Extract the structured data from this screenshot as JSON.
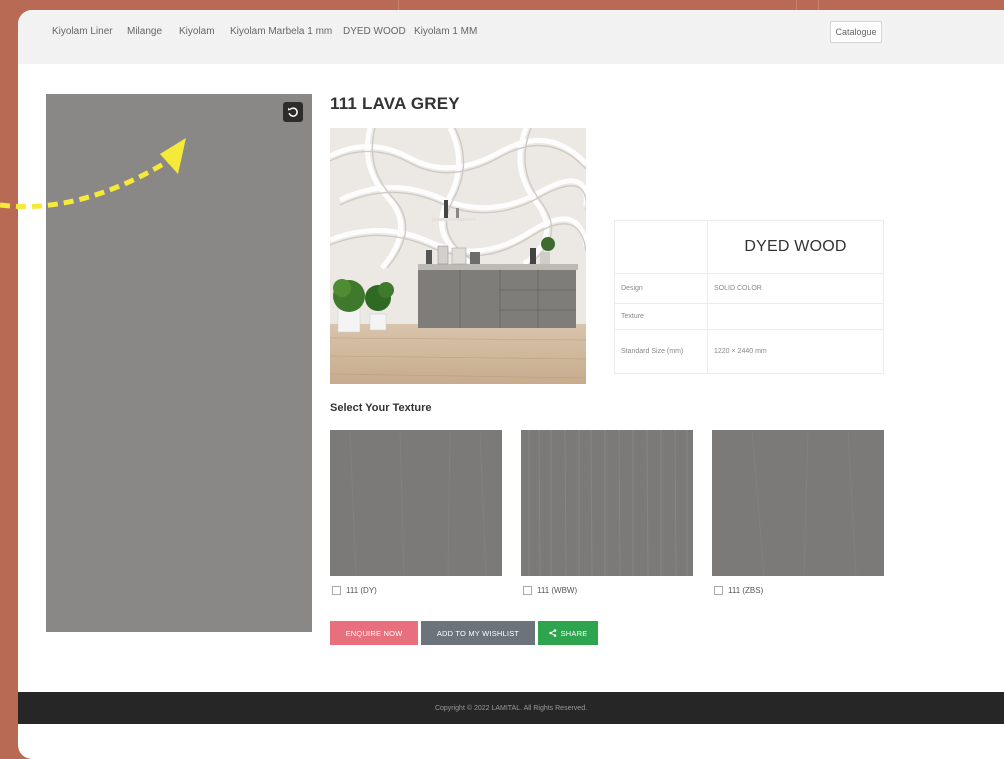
{
  "nav": {
    "items": [
      "Kiyolam Liner",
      "Milange",
      "Kiyolam",
      "Kiyolam Marbela 1 mm",
      "DYED WOOD",
      "Kiyolam 1 MM"
    ],
    "catalogue": "Catalogue"
  },
  "product": {
    "title": "111 LAVA GREY"
  },
  "spec": {
    "brand": "DYED WOOD",
    "rows": [
      {
        "label": "Design",
        "value": "SOLID COLOR"
      },
      {
        "label": "Texture",
        "value": ""
      },
      {
        "label": "Standard Size (mm)",
        "value": "1220 × 2440 mm"
      }
    ]
  },
  "textures": {
    "heading": "Select Your Texture",
    "items": [
      "111 (DY)",
      "111 (WBW)",
      "111 (ZBS)"
    ]
  },
  "actions": {
    "enquire": "ENQUIRE NOW",
    "wishlist": "ADD TO MY WISHLIST",
    "share": "SHARE"
  },
  "footer": {
    "copyright": "Copyright © 2022 LAMITAL. All Rights Reserved."
  },
  "colors": {
    "background": "#b86a55",
    "panel": "#8a8886",
    "enquire": "#e8707d",
    "wishlist": "#6c737b",
    "share": "#2ea44f",
    "footer": "#262626",
    "annotation_arrow": "#f5e93a"
  }
}
